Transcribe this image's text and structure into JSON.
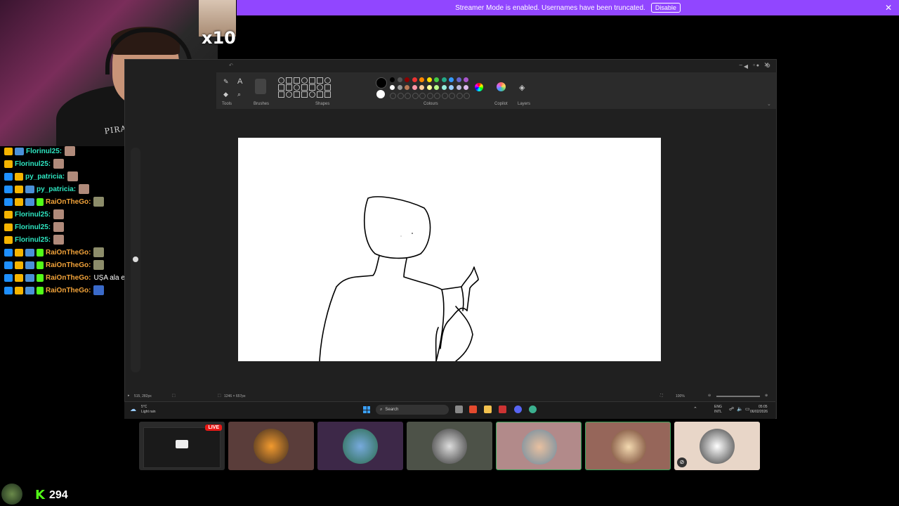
{
  "banner": {
    "text": "Streamer Mode is enabled. Usernames have been truncated.",
    "button": "Disable"
  },
  "overlay": {
    "multiplier": "x10",
    "shirt_text": "PIRATE SAILING CLUB"
  },
  "chat": [
    {
      "user": "Florinul25:",
      "color": "teal",
      "badges": [
        "crown",
        "pass"
      ],
      "emote": "face",
      "msg": ""
    },
    {
      "user": "Florinul25:",
      "color": "teal",
      "badges": [
        "crown"
      ],
      "emote": "face",
      "msg": ""
    },
    {
      "user": "py_patricia:",
      "color": "teal",
      "badges": [
        "arrow",
        "crown"
      ],
      "emote": "face",
      "msg": ""
    },
    {
      "user": "py_patricia:",
      "color": "teal",
      "badges": [
        "arrow",
        "crown",
        "pass"
      ],
      "emote": "face",
      "msg": ""
    },
    {
      "user": "RaiOnTheGo:",
      "color": "orange",
      "badges": [
        "arrow",
        "crown",
        "pass",
        "green"
      ],
      "emote": "alt",
      "msg": ""
    },
    {
      "user": "Florinul25:",
      "color": "teal",
      "badges": [
        "crown"
      ],
      "emote": "face",
      "msg": ""
    },
    {
      "user": "Florinul25:",
      "color": "teal",
      "badges": [
        "crown"
      ],
      "emote": "face",
      "msg": ""
    },
    {
      "user": "Florinul25:",
      "color": "teal",
      "badges": [
        "crown"
      ],
      "emote": "face",
      "msg": ""
    },
    {
      "user": "RaiOnTheGo:",
      "color": "orange",
      "badges": [
        "arrow",
        "crown",
        "pass",
        "green"
      ],
      "emote": "alt",
      "msg": ""
    },
    {
      "user": "RaiOnTheGo:",
      "color": "orange",
      "badges": [
        "arrow",
        "crown",
        "pass",
        "green"
      ],
      "emote": "alt",
      "msg": ""
    },
    {
      "user": "RaiOnTheGo:",
      "color": "orange",
      "badges": [
        "arrow",
        "crown",
        "pass",
        "green"
      ],
      "emote": "",
      "msg": "UȘA ala e pentru tine godene"
    },
    {
      "user": "RaiOnTheGo:",
      "color": "orange",
      "badges": [
        "arrow",
        "crown",
        "pass",
        "green"
      ],
      "emote": "blue",
      "msg": ""
    }
  ],
  "paint": {
    "groups": [
      "Tools",
      "Brushes",
      "Shapes",
      "Colours",
      "Copilot",
      "Layers"
    ],
    "status_cursor": "515, 282px",
    "status_size": "1246 × 657px",
    "zoom": "100%"
  },
  "taskbar": {
    "weather_temp": "5°C",
    "weather_desc": "Light rain",
    "search": "Search",
    "lang1": "ENG",
    "lang2": "INTL",
    "time": "05:05",
    "date": "06/02/2026"
  },
  "tiles": {
    "live_label": "LIVE"
  },
  "footer": {
    "count": "294"
  },
  "colors": {
    "banner": "#9146ff",
    "kick_green": "#53fc18",
    "username_teal": "#2ee6c1",
    "username_orange": "#f2a33a",
    "live_red": "#e91916"
  }
}
